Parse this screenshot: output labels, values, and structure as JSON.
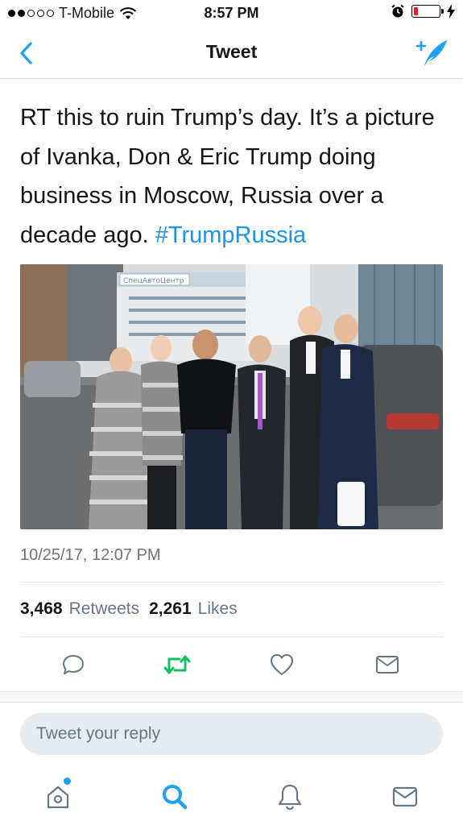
{
  "status_bar": {
    "carrier": "T-Mobile",
    "time": "8:57 PM",
    "signal_dots_filled": 2,
    "signal_dots_total": 5,
    "battery_level": 0.15,
    "icons": [
      "wifi-icon",
      "alarm-icon",
      "battery-icon",
      "charging-icon"
    ]
  },
  "nav": {
    "title": "Tweet",
    "back_icon": "chevron-left-icon",
    "compose_icon": "compose-tweet-icon"
  },
  "tweet": {
    "text_main": "RT this to ruin Trump’s day. It’s a picture of Ivanka, Don & Eric Trump doing business in Moscow, Russia over a decade ago. ",
    "hashtag": "#TrumpRussia",
    "timestamp": "10/25/17, 12:07 PM",
    "retweets_count": "3,468",
    "retweets_label": "Retweets",
    "likes_count": "2,261",
    "likes_label": "Likes",
    "photo_sign_text": "СпецАвтоЦентр"
  },
  "actions": {
    "reply_icon": "reply-icon",
    "retweet_icon": "retweet-icon",
    "like_icon": "heart-icon",
    "dm_icon": "envelope-icon",
    "retweet_color": "#17bf63"
  },
  "reply": {
    "placeholder": "Tweet your reply"
  },
  "tab_bar": {
    "tabs": [
      "home-icon",
      "search-icon",
      "notifications-icon",
      "messages-icon"
    ],
    "accent": "#1da1f2"
  }
}
